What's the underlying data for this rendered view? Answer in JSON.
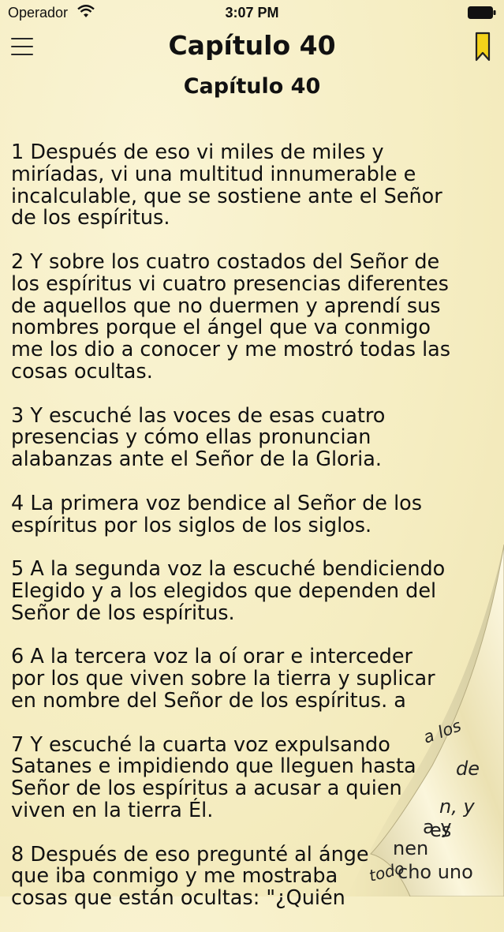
{
  "status_bar": {
    "carrier": "Operador",
    "time": "3:07 PM"
  },
  "nav": {
    "title": "Capítulo 40"
  },
  "content": {
    "heading": "Capítulo 40",
    "verses": [
      {
        "lines": [
          "1 Después de eso vi miles de miles y",
          "miríadas, vi una multitud innumerable e",
          "incalculable, que se sostiene ante el Señor",
          "de los espíritus."
        ]
      },
      {
        "lines": [
          "2 Y sobre los cuatro costados del Señor de",
          "los espíritus vi cuatro presencias diferentes",
          "de aquellos que no duermen y aprendí sus",
          "nombres porque el ángel que va conmigo",
          "me los dio a conocer y me mostró todas las",
          "cosas ocultas."
        ]
      },
      {
        "lines": [
          "3 Y escuché las voces de esas cuatro",
          "presencias y cómo ellas pronuncian",
          "alabanzas ante el Señor de la Gloria."
        ]
      },
      {
        "lines": [
          "4 La primera voz bendice al Señor de los",
          "espíritus por los siglos de los siglos."
        ]
      },
      {
        "lines": [
          "5 A la segunda voz la escuché bendiciendo",
          "Elegido y a los elegidos que dependen del",
          "Señor de los espíritus."
        ]
      },
      {
        "lines": [
          "6 A la tercera voz la oí orar e interceder",
          "por los que viven sobre la tierra y suplicar",
          "en nombre del Señor de los espíritus.     a"
        ]
      },
      {
        "lines": [
          "7 Y escuché la cuarta voz expulsando",
          "Satanes e impidiendo que lleguen hasta",
          "Señor de los espíritus a acusar a quien",
          "viven en la tierra Él."
        ]
      },
      {
        "lines": [
          "8 Después de eso pregunté al ánge",
          "que iba conmigo y me mostraba",
          "cosas que están ocultas: \"¿Quién"
        ]
      }
    ]
  },
  "curl_fragments": [
    "a los",
    "de",
    "n, y",
    "es",
    "a y",
    "nen",
    "todo",
    "cho uno"
  ]
}
